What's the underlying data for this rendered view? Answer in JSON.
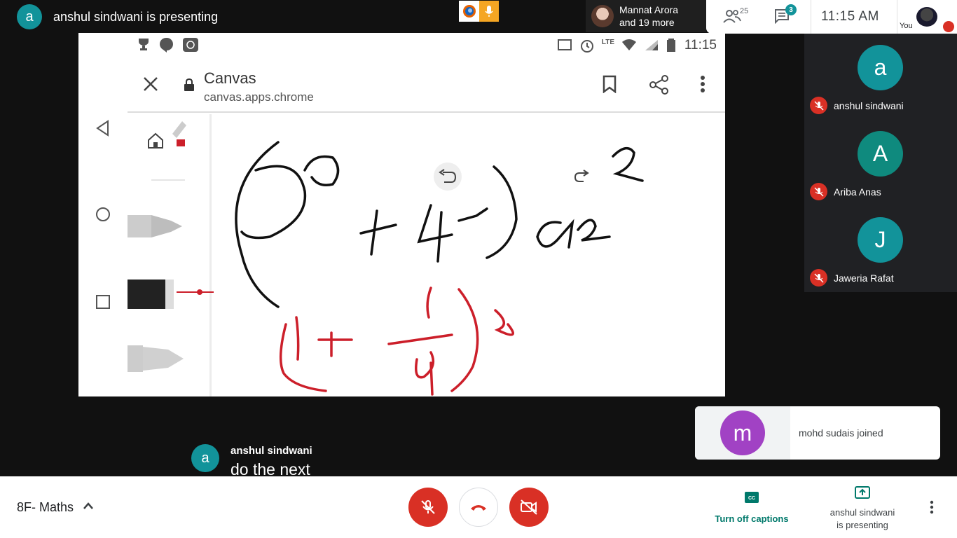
{
  "top_bar": {
    "presenter_initial": "a",
    "presenter_text": "anshul sindwani is presenting",
    "participants_line1": "Mannat Arora",
    "participants_line2": "and 19 more",
    "people_count": "25",
    "chat_badge": "3",
    "time": "11:15  AM",
    "you_label": "You"
  },
  "shared_screen": {
    "status_time": "11:15",
    "status_lte": "LTE",
    "browser_title": "Canvas",
    "browser_url": "canvas.apps.chrome"
  },
  "tiles": [
    {
      "initial": "a",
      "name": "anshul sindwani",
      "color": "#12939a"
    },
    {
      "initial": "A",
      "name": "Ariba Anas",
      "color": "#0f8a7e"
    },
    {
      "initial": "J",
      "name": "Jaweria Rafat",
      "color": "#12939a"
    }
  ],
  "toast": {
    "initial": "m",
    "message": "mohd sudais joined"
  },
  "caption": {
    "initial": "a",
    "speaker": "anshul sindwani",
    "text": "do the next"
  },
  "bottom_bar": {
    "meeting_name": "8F- Maths",
    "captions_label": "Turn off captions",
    "captions_icon_text": "CC",
    "presenting_line1": "anshul sindwani",
    "presenting_line2": "is presenting"
  },
  "colors": {
    "accent_teal": "#12939a",
    "danger_red": "#d93025",
    "caption_green": "#00796b"
  }
}
